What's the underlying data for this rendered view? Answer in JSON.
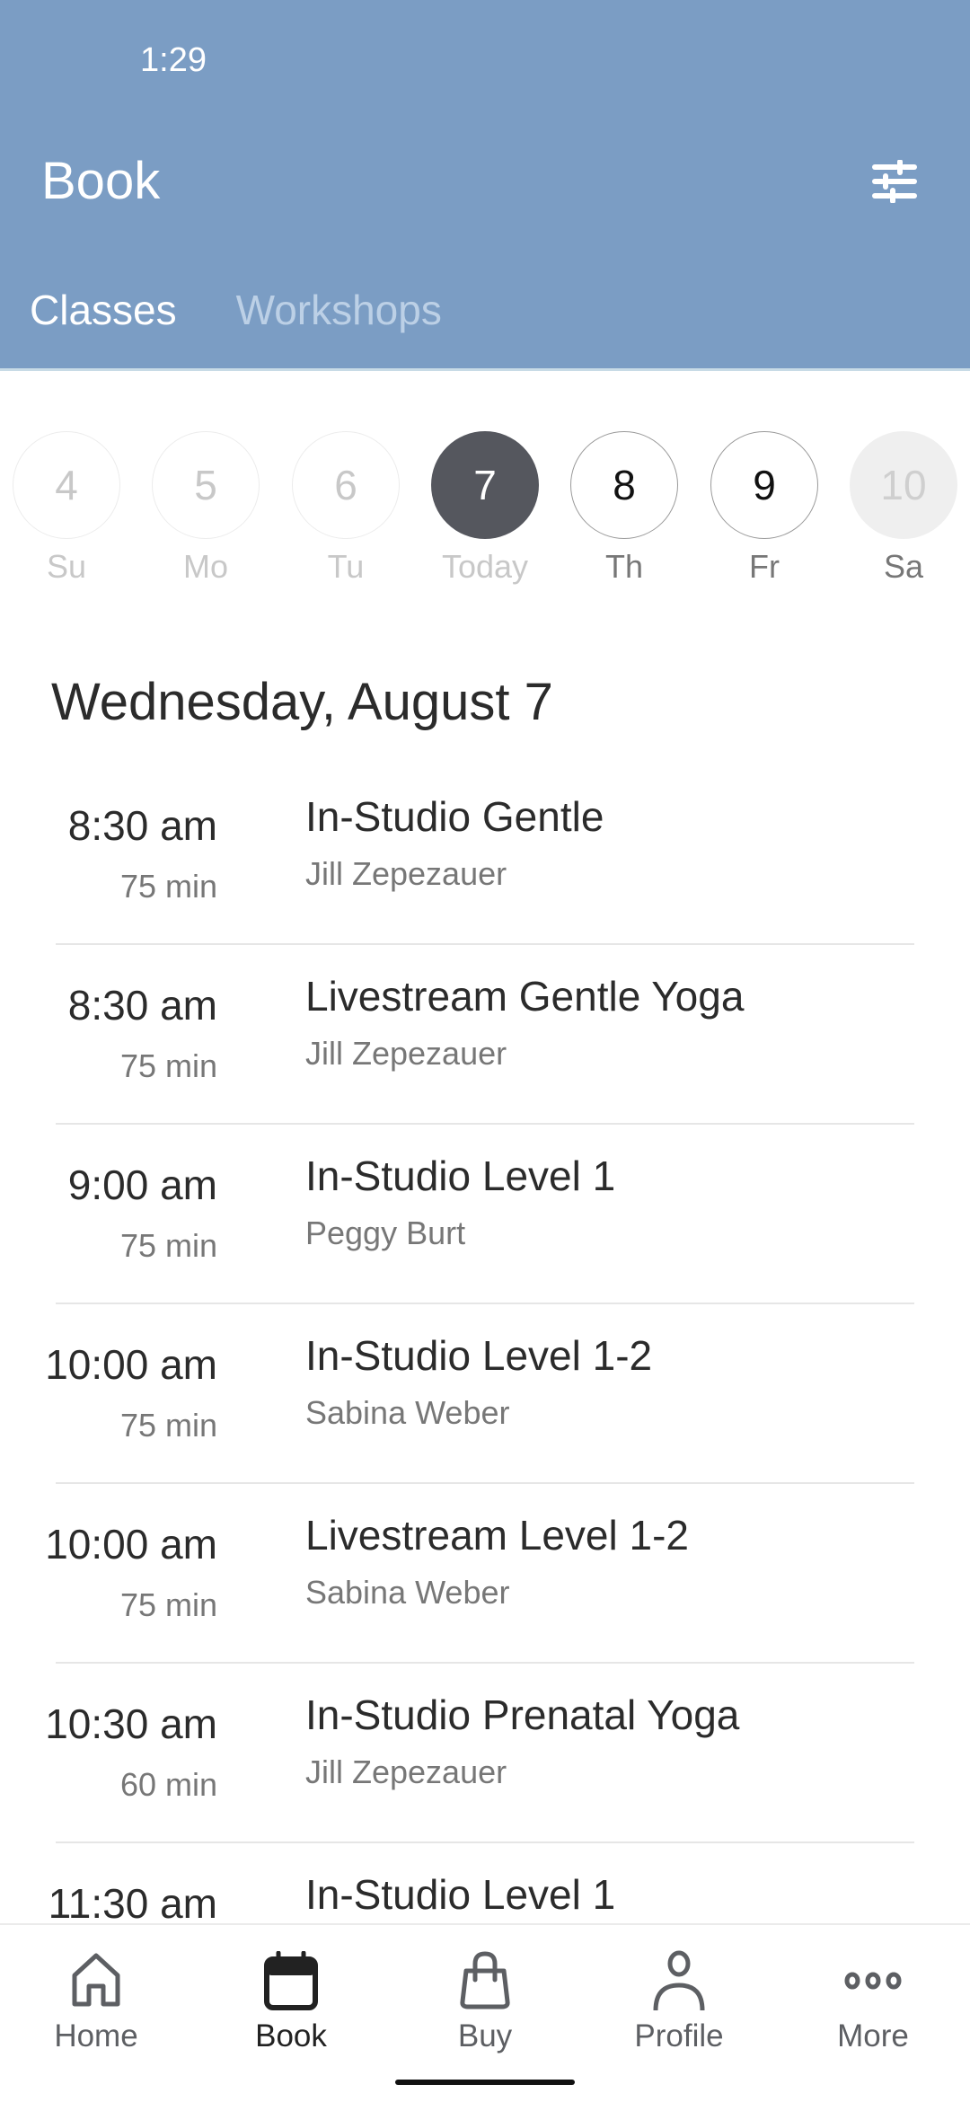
{
  "status_bar": {
    "time": "1:29"
  },
  "header": {
    "title": "Book",
    "filter_icon": "sliders-icon",
    "background": "#7b9dc4"
  },
  "tabs": [
    {
      "label": "Classes",
      "active": true
    },
    {
      "label": "Workshops",
      "active": false
    }
  ],
  "days": [
    {
      "number": "4",
      "label": "Su",
      "state": "past"
    },
    {
      "number": "5",
      "label": "Mo",
      "state": "past"
    },
    {
      "number": "6",
      "label": "Tu",
      "state": "past"
    },
    {
      "number": "7",
      "label": "Today",
      "state": "today"
    },
    {
      "number": "8",
      "label": "Th",
      "state": "future"
    },
    {
      "number": "9",
      "label": "Fr",
      "state": "future"
    },
    {
      "number": "10",
      "label": "Sa",
      "state": "disabled"
    }
  ],
  "date_heading": "Wednesday, August 7",
  "classes": [
    {
      "time": "8:30 am",
      "duration": "75 min",
      "name": "In-Studio Gentle",
      "instructor": "Jill Zepezauer"
    },
    {
      "time": "8:30 am",
      "duration": "75 min",
      "name": "Livestream Gentle Yoga",
      "instructor": "Jill Zepezauer"
    },
    {
      "time": "9:00 am",
      "duration": "75 min",
      "name": "In-Studio Level 1",
      "instructor": "Peggy Burt"
    },
    {
      "time": "10:00 am",
      "duration": "75 min",
      "name": "In-Studio Level 1-2",
      "instructor": "Sabina Weber"
    },
    {
      "time": "10:00 am",
      "duration": "75 min",
      "name": "Livestream Level 1-2",
      "instructor": "Sabina Weber"
    },
    {
      "time": "10:30 am",
      "duration": "60 min",
      "name": "In-Studio Prenatal Yoga",
      "instructor": "Jill Zepezauer"
    },
    {
      "time": "11:30 am",
      "duration": "",
      "name": "In-Studio Level 1",
      "instructor": ""
    }
  ],
  "bottom_nav": [
    {
      "label": "Home",
      "icon": "home-icon",
      "active": false
    },
    {
      "label": "Book",
      "icon": "calendar-icon",
      "active": true
    },
    {
      "label": "Buy",
      "icon": "shopping-bag-icon",
      "active": false
    },
    {
      "label": "Profile",
      "icon": "person-icon",
      "active": false
    },
    {
      "label": "More",
      "icon": "more-dots-icon",
      "active": false
    }
  ]
}
